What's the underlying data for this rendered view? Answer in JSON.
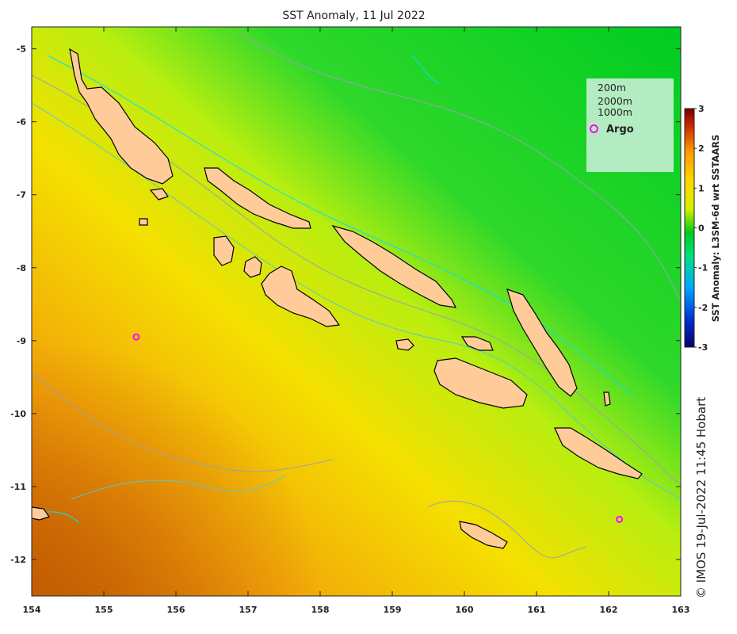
{
  "title": "SST Anomaly, 11 Jul 2022",
  "axes": {
    "x_ticks": [
      "154",
      "155",
      "156",
      "157",
      "158",
      "159",
      "160",
      "161",
      "162",
      "163"
    ],
    "y_ticks": [
      "-5",
      "-6",
      "-7",
      "-8",
      "-9",
      "-10",
      "-11",
      "-12"
    ],
    "lon_range": [
      154,
      163
    ],
    "lat_range": [
      -12.5,
      -4.7
    ]
  },
  "legend": {
    "contours": [
      "200m",
      "2000m",
      "1000m"
    ],
    "argo_label": "Argo",
    "colors": {
      "background": "#b4ecc1",
      "argo": "#ff00ff",
      "contour_200": "#00e0ff",
      "contour_1000": "#55c8d6",
      "contour_2000": "#9aa0b4"
    }
  },
  "colorbar": {
    "label": "SST Anomaly: L3SM-6d wrt SSTAARS",
    "ticks": [
      "3",
      "2",
      "1",
      "0",
      "-1",
      "-2",
      "-3"
    ],
    "range": [
      -3,
      3
    ],
    "colors": [
      "#08006e",
      "#0033d6",
      "#00a8ff",
      "#00e080",
      "#00cc1a",
      "#d8f000",
      "#ffd600",
      "#ff9a00",
      "#c82800",
      "#7a0000"
    ]
  },
  "argo_floats": [
    {
      "lon": 155.45,
      "lat": -8.95
    },
    {
      "lon": 162.15,
      "lat": -11.45
    }
  ],
  "land_color": "#ffcc99",
  "credit": "© IMOS 19-Jul-2022 11:45 Hobart"
}
